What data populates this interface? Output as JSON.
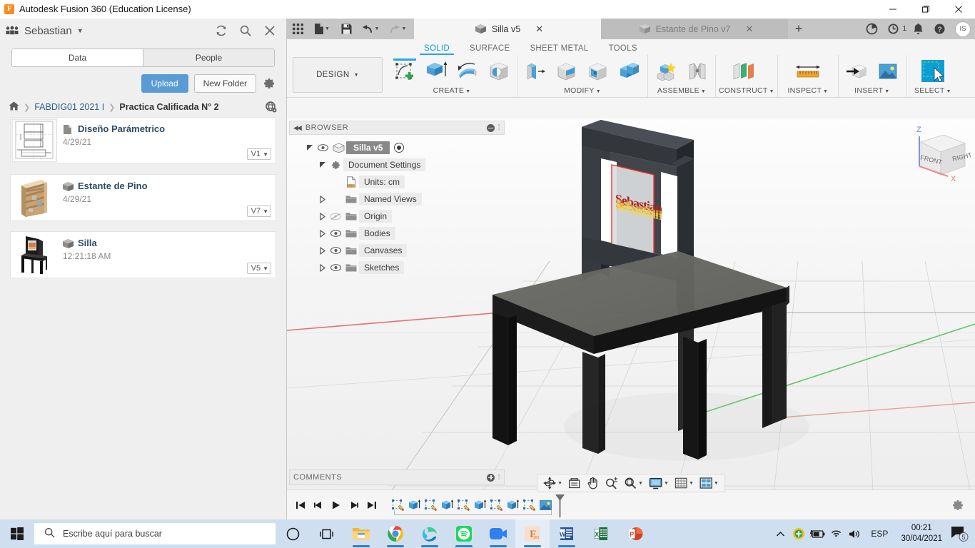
{
  "window": {
    "title": "Autodesk Fusion 360 (Education License)",
    "logo_letter": "F",
    "minimize": "−",
    "maximize": "❐",
    "close": "✕"
  },
  "data_panel": {
    "user": "Sebastian",
    "user_caret": "▼",
    "icons": {
      "refresh": "refresh-icon",
      "search": "search-icon",
      "close": "close-icon"
    },
    "tabs": [
      {
        "label": "Data",
        "active": true
      },
      {
        "label": "People",
        "active": false
      }
    ],
    "actions": {
      "upload": "Upload",
      "new_folder": "New Folder",
      "settings_icon": "gear-icon"
    },
    "breadcrumb": {
      "home_icon": "home-icon",
      "separator": "❯",
      "project": "FABDIG01 2021 I",
      "folder": "Practica Calificada N° 2",
      "globe_icon": "globe-icon"
    },
    "files": [
      {
        "name": "Diseño Parámetrico",
        "date": "4/29/21",
        "version": "V1",
        "caret": "▼",
        "thumb": "drawing",
        "type_icon": "drawing-icon"
      },
      {
        "name": "Estante de Pino",
        "date": "4/29/21",
        "version": "V7",
        "caret": "▼",
        "thumb": "shelf",
        "type_icon": "model-icon"
      },
      {
        "name": "Silla",
        "date": "12:21:18 AM",
        "version": "V5",
        "caret": "▼",
        "thumb": "chair",
        "type_icon": "model-icon"
      }
    ]
  },
  "fusion": {
    "quick_access": [
      {
        "name": "grid-apps-icon",
        "caret": false
      },
      {
        "name": "new-file-icon",
        "caret": true
      },
      {
        "name": "save-icon",
        "caret": false
      },
      {
        "name": "undo-icon",
        "caret": true
      },
      {
        "name": "redo-icon",
        "caret": true
      }
    ],
    "document_tabs": [
      {
        "label": "Silla v5",
        "active": true,
        "close": "✕"
      },
      {
        "label": "Estante de Pino v7",
        "active": false,
        "close": "✕"
      }
    ],
    "new_tab": "+",
    "right_icons": [
      {
        "name": "job-status-icon"
      },
      {
        "name": "recent-activity-icon",
        "badge": "1"
      },
      {
        "name": "notifications-bell-icon"
      },
      {
        "name": "help-icon"
      }
    ],
    "avatar_initials": "IS",
    "workspace": {
      "label": "DESIGN",
      "caret": "▼"
    },
    "ribbon_tabs": [
      {
        "label": "SOLID",
        "active": true
      },
      {
        "label": "SURFACE",
        "active": false
      },
      {
        "label": "SHEET METAL",
        "active": false
      },
      {
        "label": "TOOLS",
        "active": false
      }
    ],
    "ribbon_groups": [
      {
        "label": "CREATE",
        "caret": "▼",
        "tools": [
          "create-sketch-icon",
          "extrude-icon",
          "revolve-icon",
          "hole-icon"
        ]
      },
      {
        "label": "MODIFY",
        "caret": "▼",
        "tools": [
          "press-pull-icon",
          "fillet-icon",
          "shell-icon",
          "combine-icon"
        ]
      },
      {
        "label": "ASSEMBLE",
        "caret": "▼",
        "tools": [
          "new-component-icon",
          "joint-icon"
        ]
      },
      {
        "label": "CONSTRUCT",
        "caret": "▼",
        "tools": [
          "offset-plane-icon"
        ]
      },
      {
        "label": "INSPECT",
        "caret": "▼",
        "tools": [
          "measure-icon"
        ]
      },
      {
        "label": "INSERT",
        "caret": "▼",
        "tools": [
          "insert-derive-icon",
          "canvas-icon"
        ]
      },
      {
        "label": "SELECT",
        "caret": "▼",
        "tools": [
          "select-window-icon"
        ]
      }
    ],
    "browser": {
      "title": "BROWSER",
      "collapse_icon": "collapse-left-icon",
      "nodes": [
        {
          "label": "Silla v5",
          "indent": 0,
          "arrow": "expanded",
          "eye": true,
          "icon": "component-icon",
          "root": true,
          "radio": true
        },
        {
          "label": "Document Settings",
          "indent": 1,
          "arrow": "expanded",
          "eye": false,
          "icon": "settings-gear-icon"
        },
        {
          "label": "Units: cm",
          "indent": 2,
          "arrow": "none",
          "eye": false,
          "icon": "units-icon"
        },
        {
          "label": "Named Views",
          "indent": 1,
          "arrow": "collapsed",
          "eye": false,
          "icon": "folder-icon"
        },
        {
          "label": "Origin",
          "indent": 1,
          "arrow": "collapsed",
          "eye": "hidden",
          "icon": "folder-icon"
        },
        {
          "label": "Bodies",
          "indent": 1,
          "arrow": "collapsed",
          "eye": true,
          "icon": "folder-icon"
        },
        {
          "label": "Canvases",
          "indent": 1,
          "arrow": "collapsed",
          "eye": true,
          "icon": "folder-icon"
        },
        {
          "label": "Sketches",
          "indent": 1,
          "arrow": "collapsed",
          "eye": true,
          "icon": "folder-icon"
        }
      ]
    },
    "viewcube": {
      "front": "FRONT",
      "right": "RIGHT",
      "z": "Z",
      "x": "X"
    },
    "comments": {
      "title": "COMMENTS",
      "add_icon": "add-comment-icon"
    },
    "nav_bar": [
      {
        "name": "orbit-icon",
        "caret": true
      },
      {
        "name": "look-at-icon",
        "caret": false
      },
      {
        "name": "pan-icon",
        "caret": false
      },
      {
        "name": "zoom-icon",
        "caret": false
      },
      {
        "name": "fit-icon",
        "caret": true
      },
      {
        "name": "display-settings-icon",
        "caret": true
      },
      {
        "name": "grid-snap-icon",
        "caret": true
      },
      {
        "name": "viewports-icon",
        "caret": true
      }
    ],
    "timeline": {
      "nav": [
        "go-to-beginning-icon",
        "step-back-icon",
        "play-icon",
        "step-forward-icon",
        "go-to-end-icon"
      ],
      "features": [
        "sketch-icon",
        "extrude-icon",
        "sketch-icon",
        "extrude-icon",
        "sketch-icon",
        "extrude-icon",
        "sketch-icon",
        "extrude-icon",
        "sketch-icon",
        "canvas-icon"
      ],
      "marker": "end-marker",
      "settings_icon": "gear-icon"
    },
    "canvas_text": "Sebastian"
  },
  "taskbar": {
    "start_icon": "windows-start-icon",
    "search_placeholder": "Escribe aquí para buscar",
    "search_icon": "search-icon",
    "cortana_icon": "cortana-icon",
    "taskview_icon": "task-view-icon",
    "apps": [
      {
        "name": "file-explorer-icon",
        "running": true
      },
      {
        "name": "google-chrome-icon",
        "running": true
      },
      {
        "name": "microsoft-edge-icon",
        "running": true
      },
      {
        "name": "spotify-icon",
        "running": true
      },
      {
        "name": "zoom-icon",
        "running": false
      },
      {
        "name": "fusion360-icon",
        "running": true,
        "active": true
      },
      {
        "name": "word-icon",
        "running": true
      },
      {
        "name": "excel-icon",
        "running": false
      },
      {
        "name": "powerpoint-icon",
        "running": false
      }
    ],
    "tray": {
      "expand": "^",
      "icons": [
        "antivirus-icon",
        "battery-icon",
        "wifi-icon",
        "volume-icon"
      ],
      "language": "ESP",
      "time": "00:21",
      "date": "30/04/2021",
      "notification_count": "5",
      "notification_icon": "action-center-icon"
    }
  },
  "colors": {
    "accent_blue": "#25a7e0",
    "upload_blue": "#5b9bd5",
    "taskbar": "#cfdff0",
    "panel_bg": "#efefef",
    "ribbon_bg": "#f5f5f5"
  }
}
